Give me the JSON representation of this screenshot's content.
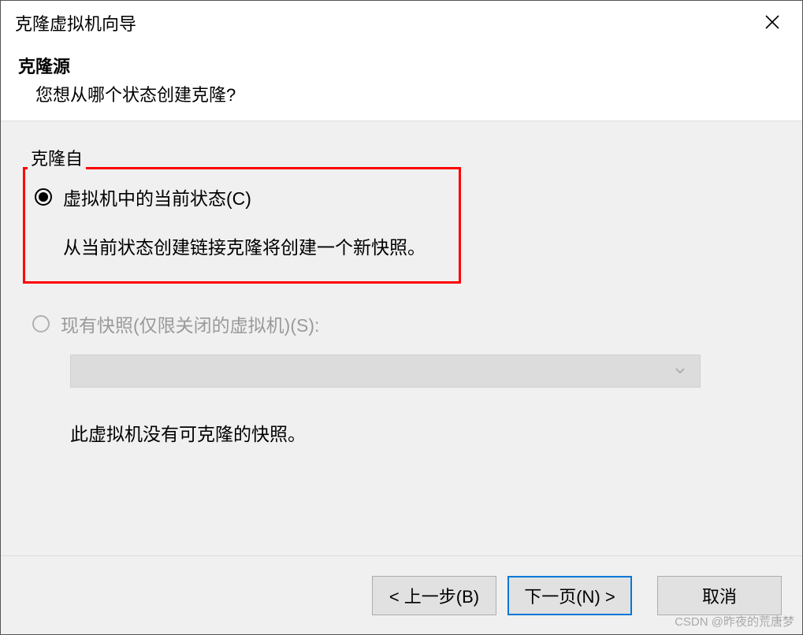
{
  "titlebar": {
    "title": "克隆虚拟机向导"
  },
  "header": {
    "title": "克隆源",
    "subtitle": "您想从哪个状态创建克隆?"
  },
  "group": {
    "legend": "克隆自",
    "option1": {
      "label": "虚拟机中的当前状态(C)",
      "description": "从当前状态创建链接克隆将创建一个新快照。",
      "selected": true
    },
    "option2": {
      "label": "现有快照(仅限关闭的虚拟机)(S):",
      "disabled": true
    },
    "no_snapshot_text": "此虚拟机没有可克隆的快照。"
  },
  "buttons": {
    "back": "< 上一步(B)",
    "next": "下一页(N) >",
    "cancel": "取消"
  },
  "watermark": "CSDN @昨夜的荒唐梦"
}
